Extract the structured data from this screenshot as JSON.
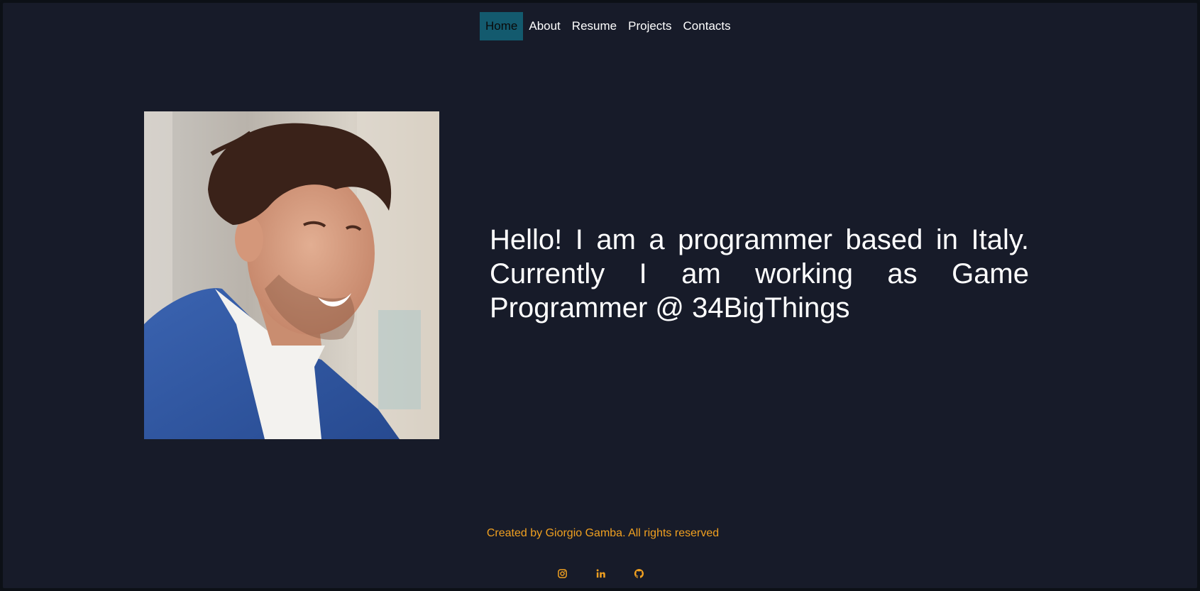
{
  "nav": {
    "items": [
      {
        "label": "Home",
        "active": true
      },
      {
        "label": "About",
        "active": false
      },
      {
        "label": "Resume",
        "active": false
      },
      {
        "label": "Projects",
        "active": false
      },
      {
        "label": "Contacts",
        "active": false
      }
    ]
  },
  "hero": {
    "intro": "Hello! I am a programmer based in Italy. Currently I am working as Game Programmer @ 34BigThings"
  },
  "footer": {
    "credit": "Created by Giorgio Gamba. All rights reserved",
    "socials": [
      {
        "icon": "instagram-icon"
      },
      {
        "icon": "linkedin-icon"
      },
      {
        "icon": "github-icon"
      }
    ]
  },
  "colors": {
    "background": "#171b29",
    "active_tab": "#135a6e",
    "accent": "#f0a020",
    "text": "#ffffff"
  }
}
